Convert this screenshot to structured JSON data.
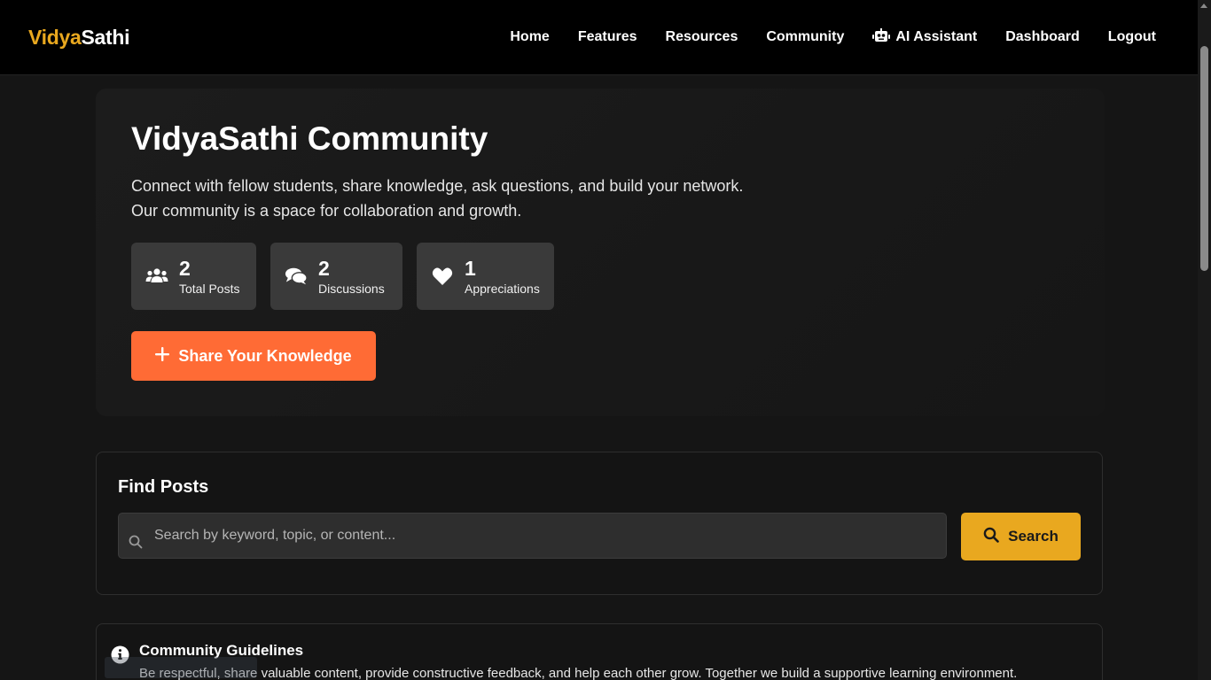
{
  "brand": {
    "part1": "Vidya",
    "part2": "Sathi",
    "accent_color": "#e9a81f"
  },
  "nav": {
    "items": [
      {
        "label": "Home"
      },
      {
        "label": "Features"
      },
      {
        "label": "Resources"
      },
      {
        "label": "Community"
      },
      {
        "label": "AI Assistant",
        "icon": "robot-icon"
      },
      {
        "label": "Dashboard"
      },
      {
        "label": "Logout"
      }
    ]
  },
  "hero": {
    "title": "VidyaSathi Community",
    "description_line1": "Connect with fellow students, share knowledge, ask questions, and build your network.",
    "description_line2": "Our community is a space for collaboration and growth.",
    "stats": [
      {
        "value": "2",
        "label": "Total Posts",
        "icon": "users-icon"
      },
      {
        "value": "2",
        "label": "Discussions",
        "icon": "comments-icon"
      },
      {
        "value": "1",
        "label": "Appreciations",
        "icon": "heart-icon"
      }
    ],
    "share_button": "Share Your Knowledge",
    "share_color": "#ff6b35"
  },
  "find": {
    "title": "Find Posts",
    "placeholder": "Search by keyword, topic, or content...",
    "value": "",
    "button": "Search"
  },
  "guidelines": {
    "title": "Community Guidelines",
    "text": "Be respectful, share valuable content, provide constructive feedback, and help each other grow. Together we build a supportive learning environment."
  }
}
